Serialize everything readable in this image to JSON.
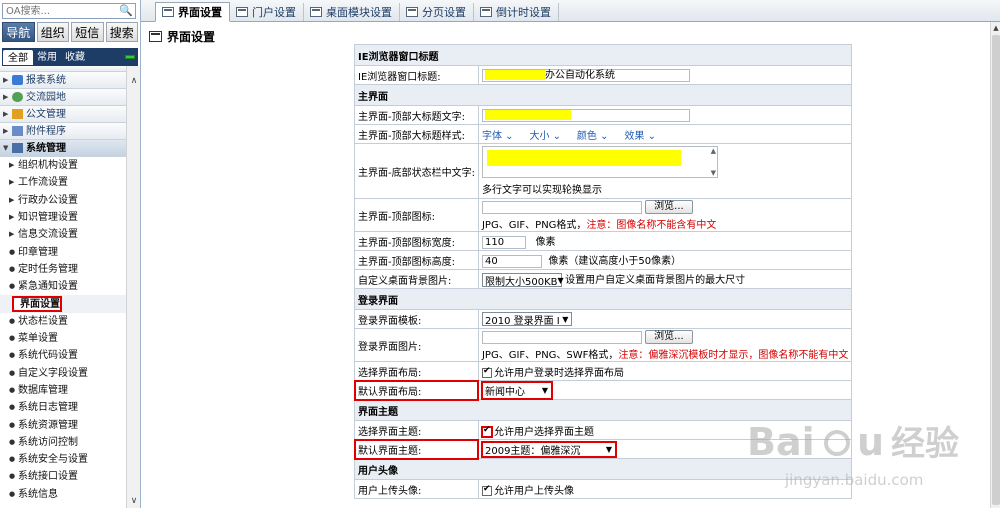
{
  "sidebar": {
    "search_placeholder": "OA搜索...",
    "main_tabs": [
      "导航",
      "组织",
      "短信",
      "搜索"
    ],
    "sub_tabs": [
      "全部",
      "常用",
      "收藏"
    ],
    "nav_headers": [
      {
        "label": "报表系统",
        "icon": "chart-icon",
        "color": "#3a7bd5"
      },
      {
        "label": "交流园地",
        "icon": "community-icon",
        "color": "#54a054"
      },
      {
        "label": "公文管理",
        "icon": "document-icon",
        "color": "#e0a020"
      },
      {
        "label": "附件程序",
        "icon": "attachment-icon",
        "color": "#6a8cc8"
      },
      {
        "label": "系统管理",
        "icon": "system-icon",
        "color": "#4a6fa5"
      }
    ],
    "sys_items": [
      "组织机构设置",
      "工作流设置",
      "行政办公设置",
      "知识管理设置",
      "信息交流设置",
      "印章管理",
      "定时任务管理",
      "紧急通知设置",
      "界面设置",
      "状态栏设置",
      "菜单设置",
      "系统代码设置",
      "自定义字段设置",
      "数据库管理",
      "系统日志管理",
      "系统资源管理",
      "系统访问控制",
      "系统安全与设置",
      "系统接口设置",
      "系统信息"
    ]
  },
  "tabs": [
    "界面设置",
    "门户设置",
    "桌面模块设置",
    "分页设置",
    "倒计时设置"
  ],
  "page_title": "界面设置",
  "form": {
    "sec_ie": "IE浏览器窗口标题",
    "ie_title_label": "IE浏览器窗口标题:",
    "ie_title_suffix": "办公自动化系统",
    "sec_main": "主界面",
    "main_big_title_label": "主界面-顶部大标题文字:",
    "main_big_style_label": "主界面-顶部大标题样式:",
    "style_font": "字体",
    "style_size": "大小",
    "style_color": "颜色",
    "style_effect": "效果",
    "status_bar_label": "主界面-底部状态栏中文字:",
    "status_bar_hint": "多行文字可以实现轮换显示",
    "top_icon_label": "主界面-顶部图标:",
    "browse": "浏览...",
    "icon_format": "JPG、GIF、PNG格式，",
    "icon_note": "注意：图像名称不能含有中文",
    "icon_width_label": "主界面-顶部图标宽度:",
    "icon_width_value": "110",
    "icon_height_label": "主界面-顶部图标高度:",
    "icon_height_value": "40",
    "pixel": "像素",
    "pixel_suggest": "像素（建议高度小于50像素）",
    "bg_label": "自定义桌面背景图片:",
    "bg_select": "限制大小500KB",
    "bg_note": "设置用户自定义桌面背景图片的最大尺寸",
    "sec_login": "登录界面",
    "login_tpl_label": "登录界面模板:",
    "login_tpl_value": "2010 登录界面 I",
    "login_img_label": "登录界面图片:",
    "login_img_format": "JPG、GIF、PNG、SWF格式，",
    "login_img_note": "注意：偏雅深沉模板时才显示，图像名称不能有中文",
    "layout_choose_label": "选择界面布局:",
    "layout_choose_text": "允许用户登录时选择界面布局",
    "layout_default_label": "默认界面布局:",
    "layout_default_value": "新闻中心",
    "sec_theme": "界面主题",
    "theme_choose_label": "选择界面主题:",
    "theme_choose_text": "允许用户选择界面主题",
    "theme_default_label": "默认界面主题:",
    "theme_default_value": "2009主题：偏雅深沉",
    "sec_avatar": "用户头像",
    "avatar_label": "用户上传头像:",
    "avatar_text": "允许用户上传头像"
  }
}
